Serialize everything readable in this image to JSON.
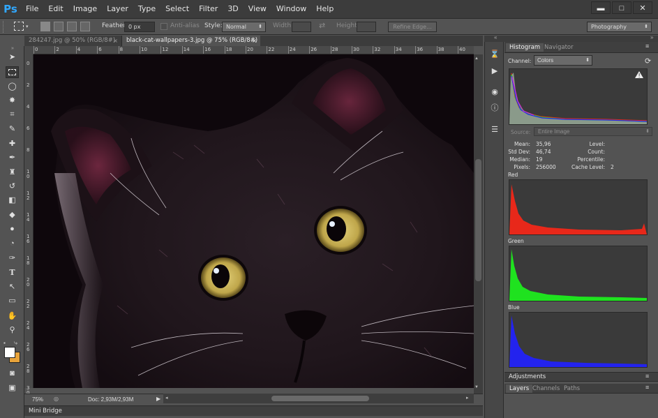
{
  "app": {
    "logo": "Ps"
  },
  "menu": [
    "File",
    "Edit",
    "Image",
    "Layer",
    "Type",
    "Select",
    "Filter",
    "3D",
    "View",
    "Window",
    "Help"
  ],
  "window_controls": {
    "minimize": "▬",
    "maximize": "□",
    "close": "✕"
  },
  "options": {
    "feather_label": "Feather:",
    "feather_value": "0 px",
    "antialias_label": "Anti-alias",
    "style_label": "Style:",
    "style_value": "Normal",
    "width_label": "Width:",
    "height_label": "Height:",
    "refine_edge": "Refine Edge...",
    "workspace": "Photography"
  },
  "tabs": [
    {
      "label": "284247.jpg @ 50% (RGB/8#)",
      "close": "×",
      "active": false
    },
    {
      "label": "black-cat-wallpapers-3.jpg @ 75% (RGB/8#)",
      "close": "×",
      "active": true
    }
  ],
  "ruler": {
    "h": [
      "0",
      "2",
      "4",
      "6",
      "8",
      "10",
      "12",
      "14",
      "16",
      "18",
      "20",
      "22",
      "24",
      "26",
      "28",
      "30",
      "32",
      "34",
      "36",
      "38",
      "40"
    ],
    "v": [
      "0",
      "2",
      "4",
      "6",
      "8",
      "1\n0",
      "1\n2",
      "1\n4",
      "1\n6",
      "1\n8",
      "2\n0",
      "2\n2",
      "2\n4",
      "2\n6",
      "2\n8",
      "3\n0"
    ]
  },
  "status": {
    "zoom": "75%",
    "doc": "Doc: 2,93M/2,93M"
  },
  "mini_bridge": "Mini Bridge",
  "panel": {
    "tabs": [
      "Histogram",
      "Navigator"
    ],
    "channel_label": "Channel:",
    "channel_value": "Colors",
    "source_label": "Source:",
    "source_value": "Entire Image",
    "stats_left": [
      {
        "label": "Mean:",
        "value": "35,96"
      },
      {
        "label": "Std Dev:",
        "value": "46,74"
      },
      {
        "label": "Median:",
        "value": "19"
      },
      {
        "label": "Pixels:",
        "value": "256000"
      }
    ],
    "stats_right": [
      {
        "label": "Level:",
        "value": ""
      },
      {
        "label": "Count:",
        "value": ""
      },
      {
        "label": "Percentile:",
        "value": ""
      },
      {
        "label": "Cache Level:",
        "value": "2"
      }
    ],
    "channels": [
      "Red",
      "Green",
      "Blue"
    ],
    "adjustments": "Adjustments",
    "bottom_tabs": [
      "Layers",
      "Channels",
      "Paths"
    ]
  },
  "colors": {
    "red": "#e8281a",
    "green": "#1fe21f",
    "blue": "#2323ee",
    "accent": "#31a8ff"
  }
}
